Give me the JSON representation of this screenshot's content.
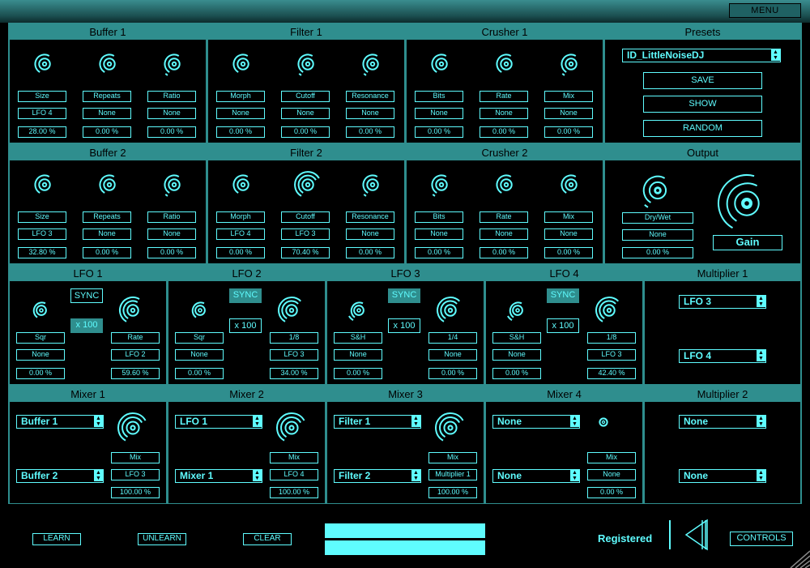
{
  "menu_label": "MENU",
  "rows": [
    {
      "panels": [
        {
          "title": "Buffer 1",
          "controls": [
            {
              "label": "Size",
              "mod": "LFO 4",
              "value": "28.00 %",
              "level": 0.28
            },
            {
              "label": "Repeats",
              "mod": "None",
              "value": "0.00 %",
              "level": 0.0
            },
            {
              "label": "Ratio",
              "mod": "None",
              "value": "0.00 %",
              "level": 0.0
            }
          ]
        },
        {
          "title": "Filter 1",
          "controls": [
            {
              "label": "Morph",
              "mod": "None",
              "value": "0.00 %",
              "level": 0.0
            },
            {
              "label": "Cutoff",
              "mod": "None",
              "value": "0.00 %",
              "level": 0.0
            },
            {
              "label": "Resonance",
              "mod": "None",
              "value": "0.00 %",
              "level": 0.0
            }
          ]
        },
        {
          "title": "Crusher 1",
          "controls": [
            {
              "label": "Bits",
              "mod": "None",
              "value": "0.00 %",
              "level": 0.0
            },
            {
              "label": "Rate",
              "mod": "None",
              "value": "0.00 %",
              "level": 0.0
            },
            {
              "label": "Mix",
              "mod": "None",
              "value": "0.00 %",
              "level": 0.0
            }
          ]
        }
      ]
    },
    {
      "panels": [
        {
          "title": "Buffer 2",
          "controls": [
            {
              "label": "Size",
              "mod": "LFO 3",
              "value": "32.80 %",
              "level": 0.33
            },
            {
              "label": "Repeats",
              "mod": "None",
              "value": "0.00 %",
              "level": 0.0
            },
            {
              "label": "Ratio",
              "mod": "None",
              "value": "0.00 %",
              "level": 0.0
            }
          ]
        },
        {
          "title": "Filter 2",
          "controls": [
            {
              "label": "Morph",
              "mod": "LFO 4",
              "value": "0.00 %",
              "level": 0.0
            },
            {
              "label": "Cutoff",
              "mod": "LFO 3",
              "value": "70.40 %",
              "level": 0.7
            },
            {
              "label": "Resonance",
              "mod": "None",
              "value": "0.00 %",
              "level": 0.0
            }
          ]
        },
        {
          "title": "Crusher 2",
          "controls": [
            {
              "label": "Bits",
              "mod": "None",
              "value": "0.00 %",
              "level": 0.0
            },
            {
              "label": "Rate",
              "mod": "None",
              "value": "0.00 %",
              "level": 0.0
            },
            {
              "label": "Mix",
              "mod": "None",
              "value": "0.00 %",
              "level": 0.0
            }
          ]
        }
      ]
    }
  ],
  "presets": {
    "title": "Presets",
    "selected": "ID_LittleNoiseDJ",
    "save": "SAVE",
    "show": "SHOW",
    "random": "RANDOM"
  },
  "output": {
    "title": "Output",
    "drywet_label": "Dry/Wet",
    "drywet_mod": "None",
    "drywet_value": "0.00 %",
    "gain_label": "Gain"
  },
  "lfos": [
    {
      "title": "LFO 1",
      "sync": "SYNC",
      "sync_on": false,
      "mult": "x 100",
      "mult_on": true,
      "shape": "Sqr",
      "shape_mod": "None",
      "shape_value": "0.00 %",
      "rate": "Rate",
      "rate_mod": "LFO 2",
      "rate_value": "59.60 %"
    },
    {
      "title": "LFO 2",
      "sync": "SYNC",
      "sync_on": true,
      "mult": "x 100",
      "mult_on": false,
      "shape": "Sqr",
      "shape_mod": "None",
      "shape_value": "0.00 %",
      "rate": "1/8",
      "rate_mod": "LFO 3",
      "rate_value": "34.00 %"
    },
    {
      "title": "LFO 3",
      "sync": "SYNC",
      "sync_on": true,
      "mult": "x 100",
      "mult_on": false,
      "shape": "S&H",
      "shape_mod": "None",
      "shape_value": "0.00 %",
      "rate": "1/4",
      "rate_mod": "None",
      "rate_value": "0.00 %"
    },
    {
      "title": "LFO 4",
      "sync": "SYNC",
      "sync_on": true,
      "mult": "x 100",
      "mult_on": false,
      "shape": "S&H",
      "shape_mod": "None",
      "shape_value": "0.00 %",
      "rate": "1/8",
      "rate_mod": "LFO 3",
      "rate_value": "42.40 %"
    }
  ],
  "multiplier1": {
    "title": "Multiplier 1",
    "a": "LFO 3",
    "b": "LFO 4"
  },
  "mixers": [
    {
      "title": "Mixer 1",
      "a": "Buffer 1",
      "b": "Buffer 2",
      "mix_label": "Mix",
      "mix_mod": "LFO 3",
      "mix_value": "100.00 %"
    },
    {
      "title": "Mixer 2",
      "a": "LFO 1",
      "b": "Mixer 1",
      "mix_label": "Mix",
      "mix_mod": "LFO 4",
      "mix_value": "100.00 %"
    },
    {
      "title": "Mixer 3",
      "a": "Filter 1",
      "b": "Filter 2",
      "mix_label": "Mix",
      "mix_mod": "Multiplier 1",
      "mix_value": "100.00 %"
    },
    {
      "title": "Mixer 4",
      "a": "None",
      "b": "None",
      "mix_label": "Mix",
      "mix_mod": "None",
      "mix_value": "0.00 %"
    }
  ],
  "multiplier2": {
    "title": "Multiplier 2",
    "a": "None",
    "b": "None"
  },
  "bottom": {
    "learn": "LEARN",
    "unlearn": "UNLEARN",
    "clear": "CLEAR",
    "registered": "Registered",
    "controls": "CONTROLS"
  },
  "colors": {
    "accent": "#5ffcff",
    "panel_header": "#2f8e8e",
    "background": "#000000"
  }
}
